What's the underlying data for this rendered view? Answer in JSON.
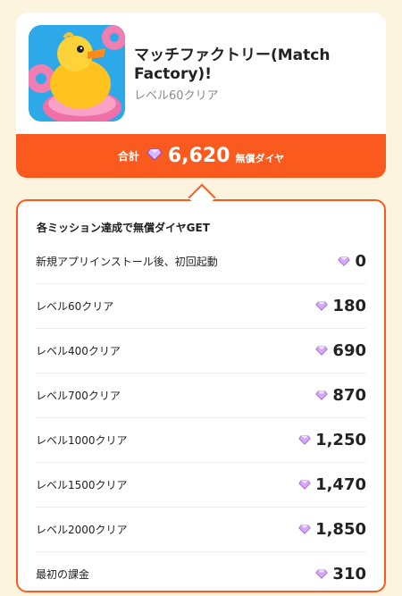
{
  "app": {
    "title": "マッチファクトリー(Match Factory)!",
    "subtitle": "レベル60クリア"
  },
  "total": {
    "label": "合計",
    "value": "6,620",
    "unit": "無償ダイヤ"
  },
  "missions": {
    "header": "各ミッション達成で無償ダイヤGET",
    "items": [
      {
        "label": "新規アプリインストール後、初回起動",
        "value": "0"
      },
      {
        "label": "レベル60クリア",
        "value": "180"
      },
      {
        "label": "レベル400クリア",
        "value": "690"
      },
      {
        "label": "レベル700クリア",
        "value": "870"
      },
      {
        "label": "レベル1000クリア",
        "value": "1,250"
      },
      {
        "label": "レベル1500クリア",
        "value": "1,470"
      },
      {
        "label": "レベル2000クリア",
        "value": "1,850"
      },
      {
        "label": "最初の課金",
        "value": "310"
      }
    ]
  },
  "colors": {
    "accent": "#fb5a1e",
    "background": "#fdf4e0",
    "gem": "#c58ef0"
  }
}
